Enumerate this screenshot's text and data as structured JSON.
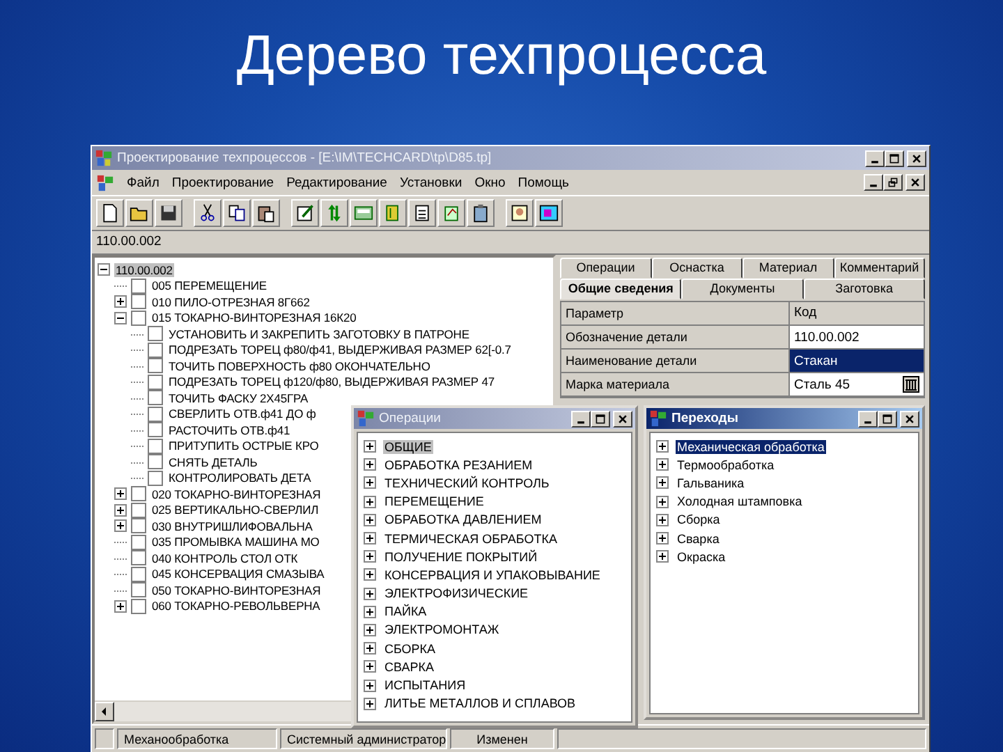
{
  "slide": {
    "title": "Дерево техпроцесса"
  },
  "window": {
    "title": "Проектирование техпроцессов - [E:\\IM\\TECHCARD\\tp\\D85.tp]"
  },
  "menu": [
    "Файл",
    "Проектирование",
    "Редактирование",
    "Установки",
    "Окно",
    "Помощь"
  ],
  "path": "110.00.002",
  "tree": {
    "label": "110.00.002",
    "selected": true,
    "expanded": true,
    "children": [
      {
        "label": "005  ПЕРЕМЕЩЕНИЕ",
        "selected": false,
        "checked": false
      },
      {
        "label": "010  ПИЛО-ОТРЕЗНАЯ   8Г662",
        "selected": false,
        "checked": false,
        "expanded": false
      },
      {
        "label": "015  ТОКАРНО-ВИНТОРЕЗНАЯ   16К20",
        "selected": false,
        "checked": false,
        "expanded": true,
        "children": [
          {
            "label": "УСТАНОВИТЬ И ЗАКРЕПИТЬ ЗАГОТОВКУ В ПАТРОНЕ",
            "selected": false,
            "checked": false
          },
          {
            "label": "ПОДРЕЗАТЬ ТОРЕЦ ф80/ф41, ВЫДЕРЖИВАЯ РАЗМЕР 62[-0.7",
            "selected": false,
            "checked": false
          },
          {
            "label": "ТОЧИТЬ ПОВЕРХНОСТЬ ф80 ОКОНЧАТЕЛЬНО",
            "selected": false,
            "checked": false
          },
          {
            "label": "ПОДРЕЗАТЬ ТОРЕЦ ф120/ф80, ВЫДЕРЖИВАЯ РАЗМЕР 47",
            "selected": false,
            "checked": false
          },
          {
            "label": "ТОЧИТЬ ФАСКУ 2Х45ГРА",
            "selected": false,
            "checked": false
          },
          {
            "label": "СВЕРЛИТЬ ОТВ.ф41 ДО ф",
            "selected": false,
            "checked": false
          },
          {
            "label": "РАСТОЧИТЬ ОТВ.ф41",
            "selected": false,
            "checked": false
          },
          {
            "label": "ПРИТУПИТЬ ОСТРЫЕ КРО",
            "selected": false,
            "checked": false
          },
          {
            "label": "СНЯТЬ ДЕТАЛЬ",
            "selected": false,
            "checked": false
          },
          {
            "label": "КОНТРОЛИРОВАТЬ ДЕТА",
            "selected": false,
            "checked": false
          }
        ]
      },
      {
        "label": "020  ТОКАРНО-ВИНТОРЕЗНАЯ",
        "selected": false,
        "checked": false,
        "expanded": false
      },
      {
        "label": "025  ВЕРТИКАЛЬНО-СВЕРЛИЛ",
        "selected": false,
        "checked": false,
        "expanded": false
      },
      {
        "label": "030  ВНУТРИШЛИФОВАЛЬНА",
        "selected": false,
        "checked": false,
        "expanded": false
      },
      {
        "label": "035  ПРОМЫВКА   МАШИНА МО",
        "selected": false,
        "checked": false
      },
      {
        "label": "040  КОНТРОЛЬ   СТОЛ ОТК",
        "selected": false,
        "checked": false
      },
      {
        "label": "045  КОНСЕРВАЦИЯ СМАЗЫВА",
        "selected": false,
        "checked": false
      },
      {
        "label": "050  ТОКАРНО-ВИНТОРЕЗНАЯ",
        "selected": false,
        "checked": false
      },
      {
        "label": "060  ТОКАРНО-РЕВОЛЬВЕРНА",
        "selected": false,
        "checked": false,
        "expanded": false
      }
    ]
  },
  "tabs": [
    [
      {
        "label": "Операции",
        "selected": false
      },
      {
        "label": "Оснастка",
        "selected": false
      },
      {
        "label": "Материал",
        "selected": false
      },
      {
        "label": "Комментарий",
        "selected": false
      }
    ],
    [
      {
        "label": "Общие сведения",
        "selected": true
      },
      {
        "label": "Документы",
        "selected": false
      },
      {
        "label": "Заготовка",
        "selected": false
      }
    ]
  ],
  "properties": {
    "columns": [
      "Параметр",
      "Код"
    ],
    "rows": [
      {
        "name": "Обозначение детали",
        "value": "110.00.002",
        "selected": false,
        "kind": "text"
      },
      {
        "name": "Наименование детали",
        "value": "Стакан",
        "selected": true,
        "kind": "text"
      },
      {
        "name": "Марка материала",
        "value": "Сталь 45",
        "selected": false,
        "kind": "picker"
      }
    ]
  },
  "operations_window": {
    "title": "Операции",
    "items": [
      {
        "label": "ОБЩИЕ",
        "selected": true
      },
      {
        "label": "ОБРАБОТКА РЕЗАНИЕМ",
        "selected": false
      },
      {
        "label": "ТЕХНИЧЕСКИЙ КОНТРОЛЬ",
        "selected": false
      },
      {
        "label": "ПЕРЕМЕЩЕНИЕ",
        "selected": false
      },
      {
        "label": "ОБРАБОТКА ДАВЛЕНИЕМ",
        "selected": false
      },
      {
        "label": "ТЕРМИЧЕСКАЯ ОБРАБОТКА",
        "selected": false
      },
      {
        "label": "ПОЛУЧЕНИЕ ПОКРЫТИЙ",
        "selected": false
      },
      {
        "label": "КОНСЕРВАЦИЯ И УПАКОВЫВАНИЕ",
        "selected": false
      },
      {
        "label": "ЭЛЕКТРОФИЗИЧЕСКИЕ",
        "selected": false
      },
      {
        "label": "ПАЙКА",
        "selected": false
      },
      {
        "label": "ЭЛЕКТРОМОНТАЖ",
        "selected": false
      },
      {
        "label": "СБОРКА",
        "selected": false
      },
      {
        "label": "СВАРКА",
        "selected": false
      },
      {
        "label": "ИСПЫТАНИЯ",
        "selected": false
      },
      {
        "label": "ЛИТЬЕ МЕТАЛЛОВ И СПЛАВОВ",
        "selected": false
      }
    ]
  },
  "transitions_window": {
    "title": "Переходы",
    "items": [
      {
        "label": "Механическая обработка",
        "selected": true
      },
      {
        "label": "Термообработка",
        "selected": false
      },
      {
        "label": "Гальваника",
        "selected": false
      },
      {
        "label": "Холодная штамповка",
        "selected": false
      },
      {
        "label": "Сборка",
        "selected": false
      },
      {
        "label": "Сварка",
        "selected": false
      },
      {
        "label": "Окраска",
        "selected": false
      }
    ]
  },
  "status_bar": [
    "Механообработка",
    "Системный администратор",
    "Изменен"
  ]
}
